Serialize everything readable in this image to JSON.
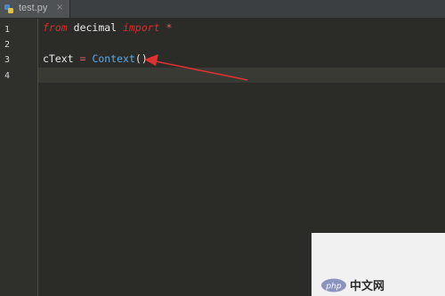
{
  "tab": {
    "label": "test.py",
    "close": "×"
  },
  "gutter": {
    "lines": [
      "1",
      "2",
      "3",
      "4"
    ]
  },
  "code": {
    "line1": {
      "kw_from": "from",
      "module": "decimal",
      "kw_import": "import",
      "star": "*"
    },
    "line3": {
      "var": "cText",
      "eq": "=",
      "cls": "Context",
      "parens": "()"
    }
  },
  "annotation": {
    "arrow_color": "#e03131"
  },
  "watermark": {
    "logo": "php",
    "text": "中文网"
  },
  "colors": {
    "background": "#2b2b27",
    "keyword": "#d92c2c",
    "class": "#5fa9e6"
  }
}
